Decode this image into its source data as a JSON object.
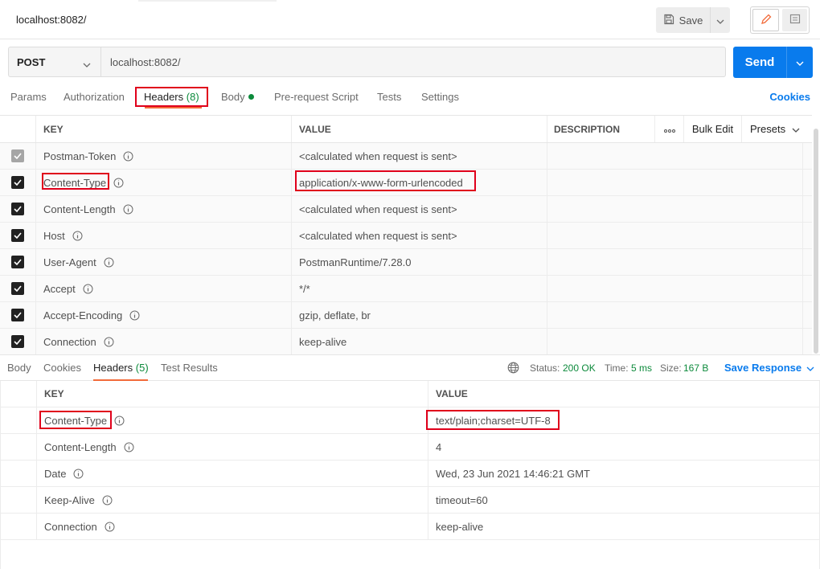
{
  "tab": {
    "title": "localhost:8082/"
  },
  "toolbar": {
    "save_label": "Save"
  },
  "request": {
    "method": "POST",
    "url": "localhost:8082/",
    "send_label": "Send"
  },
  "request_tabs": {
    "params": "Params",
    "authorization": "Authorization",
    "headers": "Headers",
    "headers_count": "(8)",
    "body": "Body",
    "prerequest": "Pre-request Script",
    "tests": "Tests",
    "settings": "Settings",
    "cookies": "Cookies"
  },
  "request_headers": {
    "columns": {
      "key": "KEY",
      "value": "VALUE",
      "description": "DESCRIPTION",
      "bulk_edit": "Bulk Edit",
      "presets": "Presets"
    },
    "rows": [
      {
        "key": "Postman-Token",
        "value": "<calculated when request is sent>",
        "checked": true,
        "disabled": true
      },
      {
        "key": "Content-Type",
        "value": "application/x-www-form-urlencoded",
        "checked": true,
        "disabled": false
      },
      {
        "key": "Content-Length",
        "value": "<calculated when request is sent>",
        "checked": true,
        "disabled": false
      },
      {
        "key": "Host",
        "value": "<calculated when request is sent>",
        "checked": true,
        "disabled": false
      },
      {
        "key": "User-Agent",
        "value": "PostmanRuntime/7.28.0",
        "checked": true,
        "disabled": false
      },
      {
        "key": "Accept",
        "value": "*/*",
        "checked": true,
        "disabled": false
      },
      {
        "key": "Accept-Encoding",
        "value": "gzip, deflate, br",
        "checked": true,
        "disabled": false
      },
      {
        "key": "Connection",
        "value": "keep-alive",
        "checked": true,
        "disabled": false
      }
    ]
  },
  "response_tabs": {
    "body": "Body",
    "cookies": "Cookies",
    "headers": "Headers",
    "headers_count": "(5)",
    "test_results": "Test Results"
  },
  "response_meta": {
    "status_label": "Status:",
    "status_value": "200 OK",
    "time_label": "Time:",
    "time_value": "5 ms",
    "size_label": "Size:",
    "size_value": "167 B",
    "save_response": "Save Response"
  },
  "response_headers": {
    "columns": {
      "key": "KEY",
      "value": "VALUE"
    },
    "rows": [
      {
        "key": "Content-Type",
        "value": "text/plain;charset=UTF-8"
      },
      {
        "key": "Content-Length",
        "value": "4"
      },
      {
        "key": "Date",
        "value": "Wed, 23 Jun 2021 14:46:21 GMT"
      },
      {
        "key": "Keep-Alive",
        "value": "timeout=60"
      },
      {
        "key": "Connection",
        "value": "keep-alive"
      }
    ]
  },
  "colors": {
    "accent": "#097bed",
    "tab_underline": "#f26b3a",
    "success": "#0c8a3b",
    "highlight": "#e0001b"
  }
}
